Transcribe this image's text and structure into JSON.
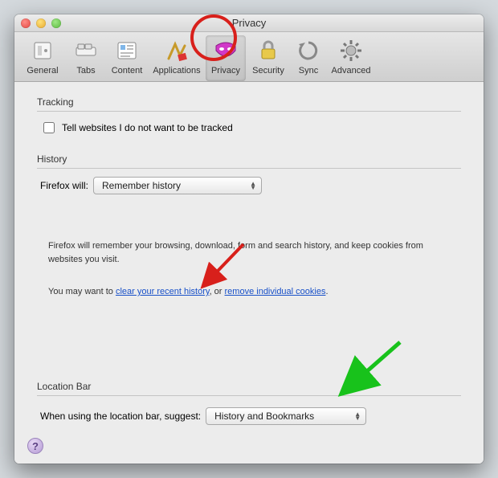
{
  "window": {
    "title": "Privacy"
  },
  "toolbar": {
    "items": [
      {
        "label": "General"
      },
      {
        "label": "Tabs"
      },
      {
        "label": "Content"
      },
      {
        "label": "Applications"
      },
      {
        "label": "Privacy"
      },
      {
        "label": "Security"
      },
      {
        "label": "Sync"
      },
      {
        "label": "Advanced"
      }
    ]
  },
  "tracking": {
    "heading": "Tracking",
    "dnt_label": "Tell websites I do not want to be tracked"
  },
  "history": {
    "heading": "History",
    "label": "Firefox will:",
    "select_value": "Remember history",
    "desc1": "Firefox will remember your browsing, download, form and search history, and keep cookies from websites you visit.",
    "desc2_pre": "You may want to ",
    "desc2_link1": "clear your recent history",
    "desc2_mid": ", or ",
    "desc2_link2": "remove individual cookies",
    "desc2_post": "."
  },
  "locationbar": {
    "heading": "Location Bar",
    "label": "When using the location bar, suggest:",
    "select_value": "History and Bookmarks"
  },
  "help": {
    "glyph": "?"
  }
}
